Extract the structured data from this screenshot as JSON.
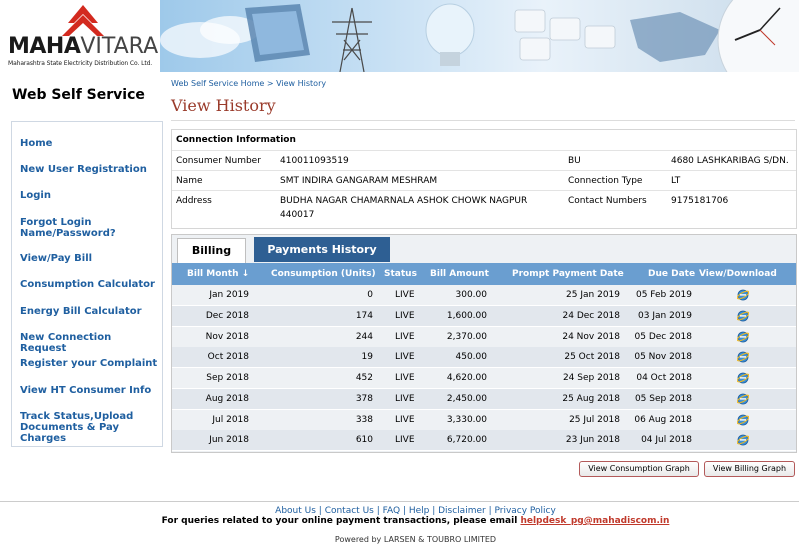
{
  "logo": {
    "brand_a": "MAHA",
    "brand_b": "VITARAN",
    "subtitle": "Maharashtra State Electricity Distribution Co. Ltd."
  },
  "sidebar": {
    "title": "Web Self Service",
    "items": [
      {
        "label": "Home"
      },
      {
        "label": "New User Registration"
      },
      {
        "label": "Login"
      },
      {
        "label": "Forgot Login Name/Password?"
      },
      {
        "label": "View/Pay Bill"
      },
      {
        "label": "Consumption Calculator"
      },
      {
        "label": "Energy Bill Calculator"
      },
      {
        "label": "New Connection Request"
      },
      {
        "label": "Register your Complaint"
      },
      {
        "label": "View HT Consumer Info"
      },
      {
        "label": "Track Status,Upload Documents & Pay Charges"
      }
    ]
  },
  "breadcrumb": {
    "home": "Web Self Service Home",
    "sep": ">",
    "current": "View History"
  },
  "page_title": "View History",
  "connection": {
    "heading": "Connection Information",
    "consumer_number_label": "Consumer Number",
    "consumer_number": "410011093519",
    "bu_label": "BU",
    "bu": "4680 LASHKARIBAG S/DN.",
    "name_label": "Name",
    "name": "SMT INDIRA GANGARAM MESHRAM",
    "connection_type_label": "Connection Type",
    "connection_type": "LT",
    "address_label": "Address",
    "address": "BUDHA NAGAR CHAMARNALA ASHOK CHOWK NAGPUR 440017",
    "contact_label": "Contact Numbers",
    "contact": "9175181706"
  },
  "tabs": {
    "billing": "Billing",
    "payments": "Payments History"
  },
  "grid": {
    "headers": [
      "Bill Month ↓",
      "Consumption (Units)",
      "Status",
      "Bill Amount",
      "Prompt Payment Date",
      "Due Date",
      "View/Download"
    ],
    "rows": [
      {
        "month": "Jan 2019",
        "units": "0",
        "status": "LIVE",
        "amount": "300.00",
        "prompt": "25 Jan 2019",
        "due": "05 Feb 2019"
      },
      {
        "month": "Dec 2018",
        "units": "174",
        "status": "LIVE",
        "amount": "1,600.00",
        "prompt": "24 Dec 2018",
        "due": "03 Jan 2019"
      },
      {
        "month": "Nov 2018",
        "units": "244",
        "status": "LIVE",
        "amount": "2,370.00",
        "prompt": "24 Nov 2018",
        "due": "05 Dec 2018"
      },
      {
        "month": "Oct 2018",
        "units": "19",
        "status": "LIVE",
        "amount": "450.00",
        "prompt": "25 Oct 2018",
        "due": "05 Nov 2018"
      },
      {
        "month": "Sep 2018",
        "units": "452",
        "status": "LIVE",
        "amount": "4,620.00",
        "prompt": "24 Sep 2018",
        "due": "04 Oct 2018"
      },
      {
        "month": "Aug 2018",
        "units": "378",
        "status": "LIVE",
        "amount": "2,450.00",
        "prompt": "25 Aug 2018",
        "due": "05 Sep 2018"
      },
      {
        "month": "Jul 2018",
        "units": "338",
        "status": "LIVE",
        "amount": "3,330.00",
        "prompt": "25 Jul 2018",
        "due": "06 Aug 2018"
      },
      {
        "month": "Jun 2018",
        "units": "610",
        "status": "LIVE",
        "amount": "6,720.00",
        "prompt": "23 Jun 2018",
        "due": "04 Jul 2018"
      }
    ]
  },
  "buttons": {
    "consumption_graph": "View Consumption Graph",
    "billing_graph": "View Billing Graph"
  },
  "footer": {
    "links": [
      "About Us",
      "Contact Us",
      "FAQ",
      "Help",
      "Disclaimer",
      "Privacy Policy"
    ],
    "link_sep": " | ",
    "note": "For queries related to your online payment transactions, please email ",
    "email": "helpdesk_pg@mahadiscom.in",
    "powered": "Powered by LARSEN & TOUBRO LIMITED"
  },
  "colors": {
    "link_blue": "#1f5fa0",
    "title_red": "#9a3b2b",
    "grid_header": "#6a9ed0",
    "tab_active_bg": "#2e5f93",
    "row_even": "#eef1f4",
    "row_odd": "#e2e7ed"
  }
}
